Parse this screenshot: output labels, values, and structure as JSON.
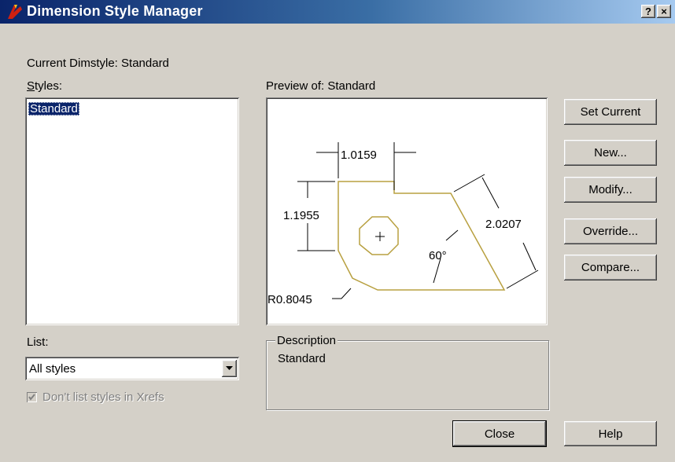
{
  "window": {
    "title": "Dimension Style Manager",
    "help_btn": "?",
    "close_btn": "×"
  },
  "current_dimstyle": "Current Dimstyle: Standard",
  "styles": {
    "label": "Styles:",
    "items": [
      "Standard"
    ]
  },
  "preview": {
    "label": "Preview of: Standard",
    "dims": {
      "width": "1.0159",
      "height": "1.1955",
      "slant": "2.0207",
      "angle": "60°",
      "radius": "R0.8045"
    },
    "colors": {
      "outline": "#b8a040"
    }
  },
  "buttons": {
    "set_current": "Set Current",
    "new": "New...",
    "modify": "Modify...",
    "override": "Override...",
    "compare": "Compare...",
    "close": "Close",
    "help": "Help"
  },
  "list": {
    "label": "List:",
    "selected": "All styles",
    "xrefs_checkbox": "Don't list styles in Xrefs",
    "xrefs_checked": true
  },
  "description": {
    "legend": "Description",
    "text": "Standard"
  }
}
